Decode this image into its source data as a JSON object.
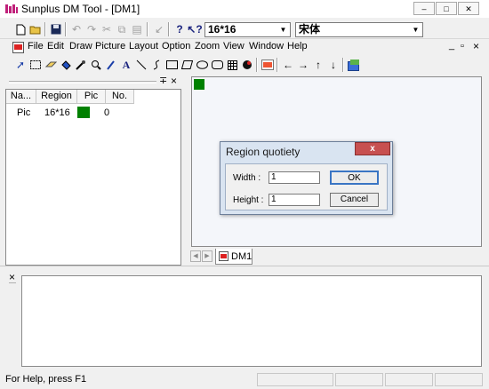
{
  "window": {
    "title": "Sunplus DM Tool - [DM1]",
    "controls": {
      "minimize": "–",
      "maximize": "□",
      "close": "✕"
    }
  },
  "toolbar": {
    "font_size_value": "16*16",
    "font_name_value": "宋体"
  },
  "menu": {
    "items": [
      "File",
      "Edit",
      "Draw",
      "Picture",
      "Layout",
      "Option",
      "Zoom",
      "View",
      "Window",
      "Help"
    ],
    "mdi_controls": {
      "minimize": "_",
      "restore": "▫",
      "close": "×"
    }
  },
  "left_panel": {
    "controls": {
      "pin": "∓",
      "close": "×"
    },
    "columns": [
      "Na...",
      "Region",
      "Pic",
      "No."
    ],
    "rows": [
      {
        "name": "Pic",
        "region": "16*16",
        "pic_color": "#008000",
        "no": "0"
      }
    ]
  },
  "canvas": {
    "pixel_color": "#008000"
  },
  "tabs": {
    "scroll_left": "◀",
    "scroll_right": "▶",
    "items": [
      {
        "label": "DM1",
        "icon": "dm-doc-icon"
      }
    ]
  },
  "bottom_panel": {
    "close": "×"
  },
  "dialog": {
    "title": "Region quotiety",
    "close": "x",
    "width_label": "Width :",
    "width_value": "1",
    "height_label": "Height :",
    "height_value": "1",
    "ok_label": "OK",
    "cancel_label": "Cancel"
  },
  "status": {
    "text": "For Help, press F1"
  },
  "colors": {
    "accent_green": "#008000",
    "dialog_frame": "#d9e4f1",
    "close_red": "#c75050"
  }
}
